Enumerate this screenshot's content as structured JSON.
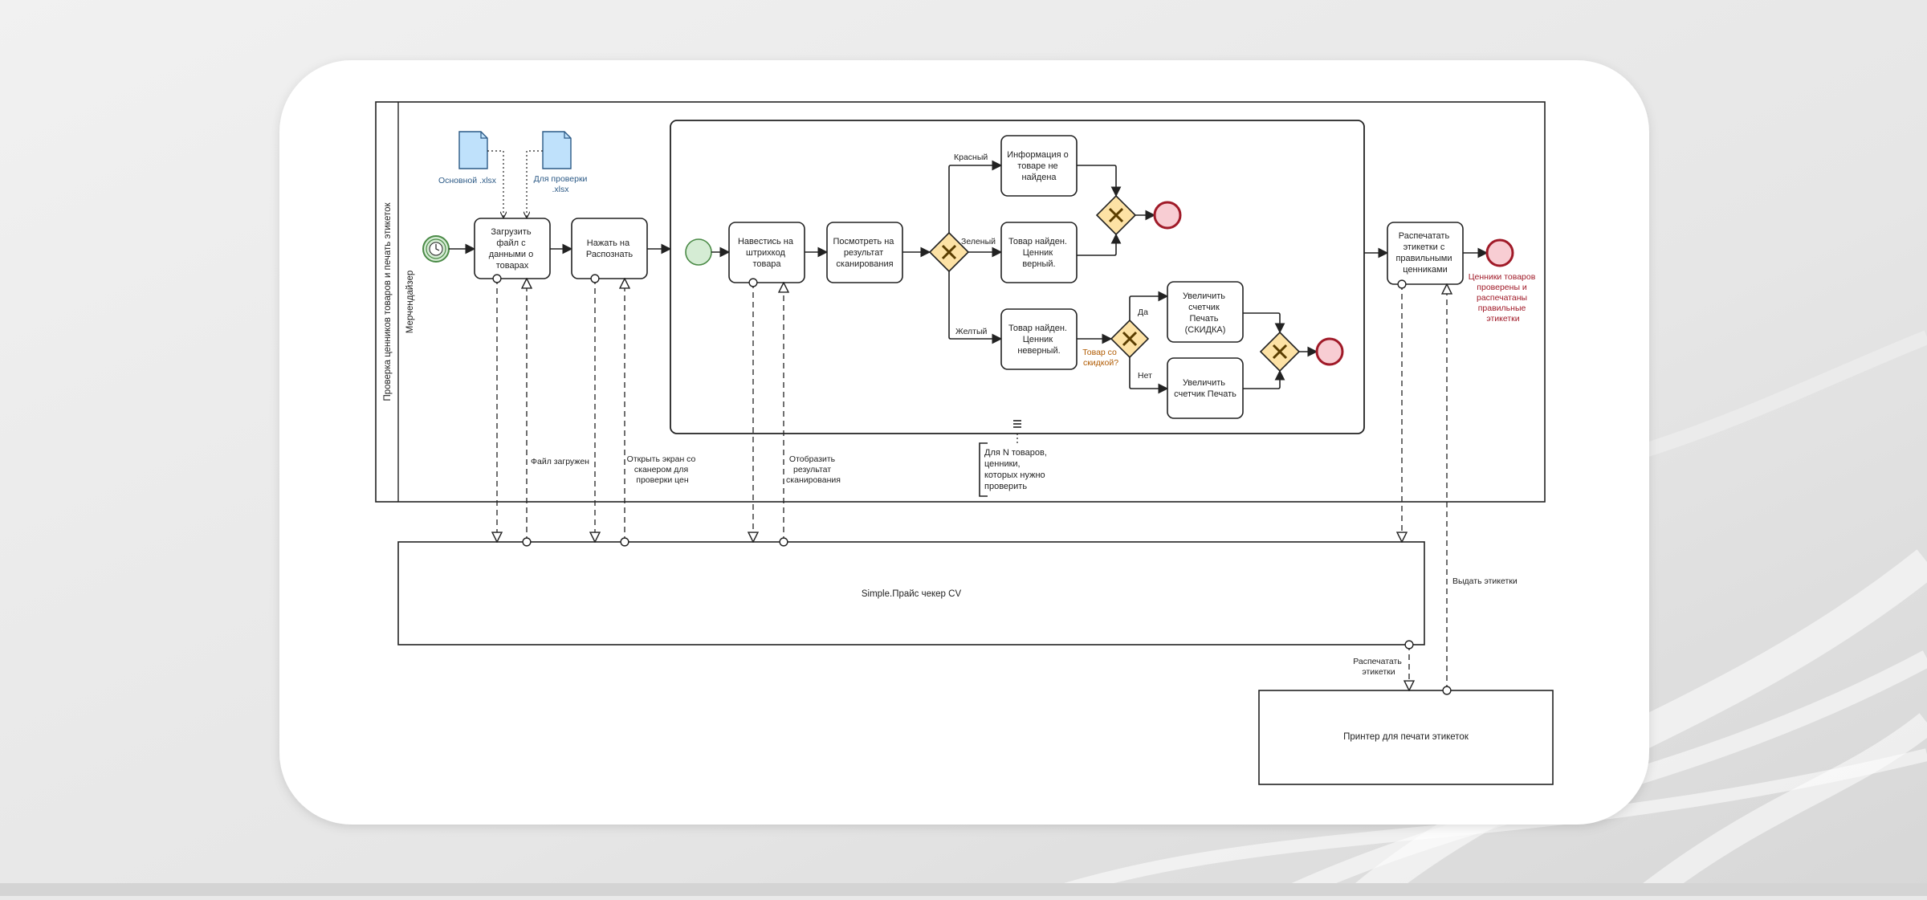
{
  "pool": {
    "title": "Проверка ценников товаров и печать этикеток",
    "lane": "Мерчендайзер"
  },
  "docs": {
    "main_file": "Основной .xlsx",
    "check_file_line1": "Для проверки",
    "check_file_line2": ".xlsx"
  },
  "tasks": {
    "upload": [
      "Загрузить",
      "файл с",
      "данными о",
      "товарах"
    ],
    "recognize": [
      "Нажать на",
      "Распознать"
    ],
    "scan": [
      "Навестись на",
      "штрихкод",
      "товара"
    ],
    "view_result": [
      "Посмотреть на",
      "результат",
      "сканирования"
    ],
    "not_found": [
      "Информация о",
      "товаре не",
      "найдена"
    ],
    "correct": [
      "Товар найден.",
      "Ценник",
      "верный."
    ],
    "incorrect": [
      "Товар найден.",
      "Ценник",
      "неверный."
    ],
    "inc_discount": [
      "Увеличить",
      "счетчик",
      "Печать",
      "(СКИДКА)"
    ],
    "inc_print": [
      "Увеличить",
      "счетчик Печать"
    ],
    "print_labels": [
      "Распечатать",
      "этикетки с",
      "правильными",
      "ценниками"
    ]
  },
  "flows": {
    "red": "Красный",
    "green": "Зеленый",
    "yellow": "Желтый",
    "yes": "Да",
    "no": "Нет",
    "discount_q": [
      "Товар со",
      "скидкой?"
    ]
  },
  "end_event": [
    "Ценники товаров",
    "проверены и",
    "распечатаны",
    "правильные",
    "этикетки"
  ],
  "loop_annotation": [
    "Для N товаров,",
    "ценники,",
    "которых нужно",
    "проверить"
  ],
  "messages": {
    "file_loaded": "Файл загружен",
    "open_scanner": [
      "Открыть экран со",
      "сканером для",
      "проверки цен"
    ],
    "show_result": [
      "Отобразить",
      "результат",
      "сканирования"
    ],
    "print_labels_msg": [
      "Распечатать",
      "этикетки"
    ],
    "issue_labels": "Выдать этикетки"
  },
  "systems": {
    "app": "Simple.Прайс чекер CV",
    "printer": "Принтер для печати этикеток"
  },
  "colors": {
    "start": "#d5ecd4",
    "start_stroke": "#4a8a46",
    "end_fill": "#f8cdd3",
    "end_stroke": "#a01a28",
    "gateway": "#fde2a5",
    "doc": "#bfe1fb",
    "doc_stroke": "#2c5a86",
    "question": "#b05a00",
    "end_label": "#a01a28"
  }
}
